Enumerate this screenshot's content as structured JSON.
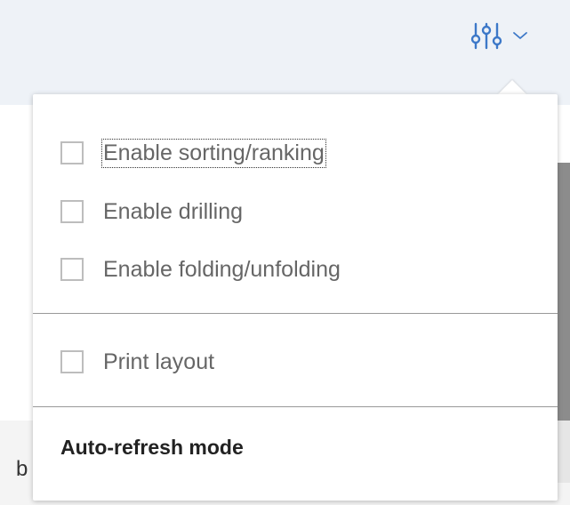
{
  "header": {
    "settings_icon": "sliders-icon",
    "dropdown_icon": "chevron-down-icon"
  },
  "background": {
    "partial_text": "b"
  },
  "menu": {
    "options": [
      {
        "label": "Enable sorting/ranking",
        "checked": false
      },
      {
        "label": "Enable drilling",
        "checked": false
      },
      {
        "label": "Enable folding/unfolding",
        "checked": false
      }
    ],
    "print_option": {
      "label": "Print layout",
      "checked": false
    },
    "auto_refresh_label": "Auto-refresh mode"
  },
  "colors": {
    "header_bg": "#eef2f7",
    "icon_blue": "#3c78c8",
    "text_gray": "#666666",
    "divider": "#999999"
  }
}
